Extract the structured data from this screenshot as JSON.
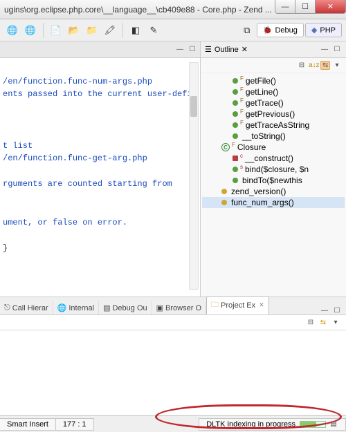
{
  "title": "ugins\\org.eclipse.php.core\\__language__\\cb409e88 - Core.php - Zend ...",
  "perspectives": {
    "debug": "Debug",
    "php": "PHP"
  },
  "editor": {
    "lines": [
      "",
      "/en/function.func-num-args.php",
      "ents passed into the current user-defin",
      "",
      "",
      "",
      "t list",
      "/en/function.func-get-arg.php",
      "",
      "rguments are counted starting from",
      "",
      "",
      "ument, or false on error.",
      "",
      "}",
      "",
      "",
      ""
    ]
  },
  "outline": {
    "title": "Outline",
    "items": [
      {
        "kind": "method",
        "label": "getFile()"
      },
      {
        "kind": "method",
        "label": "getLine()"
      },
      {
        "kind": "method",
        "label": "getTrace()"
      },
      {
        "kind": "method",
        "label": "getPrevious()"
      },
      {
        "kind": "method",
        "label": "getTraceAsString"
      },
      {
        "kind": "method",
        "label": "__toString()"
      },
      {
        "kind": "class",
        "label": "Closure"
      },
      {
        "kind": "ctor",
        "label": "__construct()"
      },
      {
        "kind": "static",
        "label": "bind($closure, $n"
      },
      {
        "kind": "method2",
        "label": "bindTo($newthis"
      },
      {
        "kind": "func",
        "label": "zend_version()"
      },
      {
        "kind": "func",
        "label": "func_num_args()",
        "selected": true
      }
    ]
  },
  "views": {
    "tabs": [
      "Call Hierar",
      "Internal",
      "Debug Ou",
      "Browser O",
      "Project Ex"
    ],
    "active": 4
  },
  "status": {
    "insert": "Smart Insert",
    "pos": "177 : 1",
    "progress": "DLTK indexing in progress"
  }
}
